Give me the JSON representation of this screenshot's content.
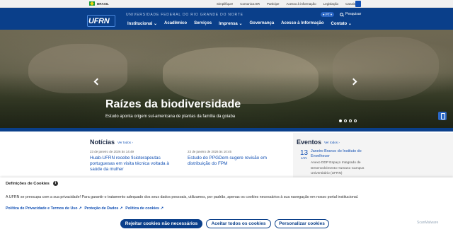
{
  "govbar": {
    "country": "BRASIL",
    "links": [
      "Simplifique!",
      "Comunica BR",
      "Participe",
      "Acesso à informação",
      "Legislação",
      "Canais"
    ]
  },
  "header": {
    "logo": "UFRN",
    "university": "UNIVERSIDADE FEDERAL DO RIO GRANDE DO NORTE",
    "language": "PT",
    "search_label": "Pesquisar",
    "nav": [
      "Institucional",
      "Acadêmico",
      "Serviços",
      "Imprensa",
      "Governança",
      "Acesso à Informação",
      "Contato"
    ]
  },
  "hero": {
    "title": "Raízes da biodiversidade",
    "subtitle": "Estudo aponta origem sul-americana de plantas da família da goiaba",
    "slides": 4,
    "active_slide": 1
  },
  "noticias": {
    "title": "Notícias",
    "ver_todos": "Ver todos",
    "items": [
      {
        "date": "23 de janeiro de 2026 às 14:49",
        "title": "Huab-UFRN recebe fisioterapeutas portuguesas em visita técnica voltada à saúde da mulher"
      },
      {
        "date": "23 de janeiro de 2026 às 10:45",
        "title": "Estudo do PPGDem sugere revisão em distribuição do FPM"
      }
    ]
  },
  "eventos": {
    "title": "Eventos",
    "ver_todos": "Ver todos",
    "items": [
      {
        "day": "13",
        "month": "JAN",
        "title": "Janeiro Branco do Instituto do Envelhecer",
        "place": "Anexo DDP Espaço Integrado de Desenvolvimento Humano Campus Universitário (UFRN)"
      }
    ]
  },
  "cookies": {
    "title": "Definições de Cookies",
    "text": "A UFRN se preocupa com a sua privacidade! Para garantir o tratamento adequado dos seus dados pessoais, utilizamos, por padrão, apenas os cookies necessários à sua navegação em nosso portal institucional.",
    "links": [
      "Política de Privacidade e Termos de Uso",
      "Proteção de Dados",
      "Política de cookies"
    ],
    "reject": "Rejeitar cookies não necessários",
    "accept": "Aceitar todos os cookies",
    "prefs": "Personalizar cookies"
  },
  "watermark": "ScanMalware"
}
